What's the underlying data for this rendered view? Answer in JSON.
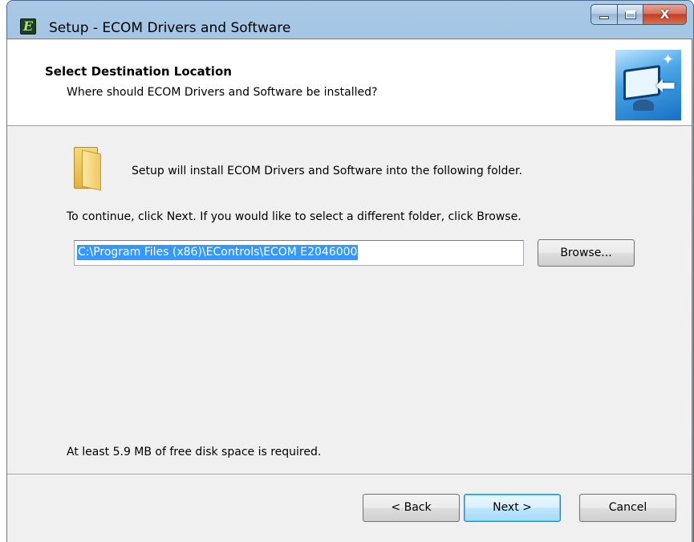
{
  "window": {
    "title": "Setup - ECOM Drivers and Software",
    "app_icon_glyph": "E",
    "close_glyph": "X"
  },
  "header": {
    "title": "Select Destination Location",
    "subtitle": "Where should ECOM Drivers and Software be installed?"
  },
  "body": {
    "info_text": "Setup will install ECOM Drivers and Software into the following folder.",
    "continue_text": "To continue, click Next. If you would like to select a different folder, click Browse.",
    "path_value": "C:\\Program Files (x86)\\EControls\\ECOM E2046000",
    "browse_label": "Browse...",
    "disk_space_text": "At least 5.9 MB of free disk space is required."
  },
  "footer": {
    "back_label": "< Back",
    "next_label": "Next >",
    "cancel_label": "Cancel"
  },
  "icons": {
    "app": "ecom-app-icon",
    "wizard_image": "computer-monitor-install-icon",
    "folder": "folder-icon"
  },
  "colors": {
    "selection": "#3399ff",
    "client_bg": "#f0f0f0",
    "header_bg": "#ffffff"
  }
}
